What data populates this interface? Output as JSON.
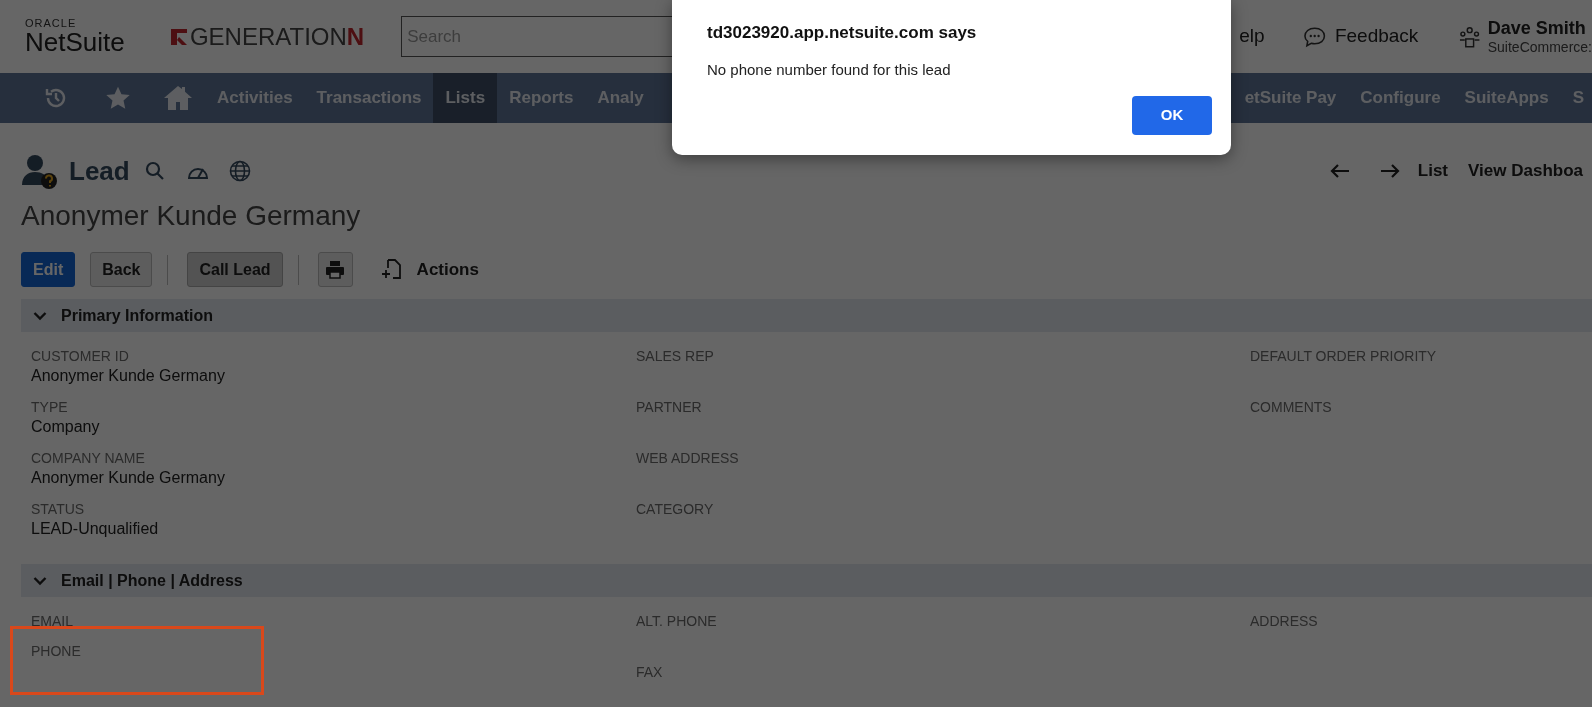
{
  "header": {
    "brand_super": "ORACLE",
    "brand": "NetSuite",
    "partner": {
      "text": "GENERATION",
      "accent": "N"
    },
    "search": {
      "placeholder": "Search"
    },
    "help": "elp",
    "feedback": "Feedback",
    "user": {
      "name": "Dave Smith",
      "role": "SuiteCommerce:"
    }
  },
  "nav": {
    "items_left": [
      {
        "label": "Activities",
        "selected": false
      },
      {
        "label": "Transactions",
        "selected": false
      },
      {
        "label": "Lists",
        "selected": true
      },
      {
        "label": "Reports",
        "selected": false
      },
      {
        "label": "Analy",
        "selected": false
      }
    ],
    "items_right": [
      {
        "label": "etSuite Pay",
        "selected": false
      },
      {
        "label": "Configure",
        "selected": false
      },
      {
        "label": "SuiteApps",
        "selected": false
      },
      {
        "label": "S",
        "selected": false
      }
    ]
  },
  "record": {
    "type": "Lead",
    "name": "Anonymer Kunde Germany",
    "page_links": [
      "List",
      "View Dashboa"
    ],
    "buttons": [
      {
        "label": "Edit",
        "kind": "primary"
      },
      {
        "label": "Back",
        "kind": "secondary"
      },
      {
        "label": "Call Lead",
        "kind": "pressed"
      }
    ],
    "actions": "Actions"
  },
  "sections": [
    {
      "title": "Primary Information",
      "expanded": true,
      "columns": [
        [
          {
            "label": "CUSTOMER ID",
            "value": "Anonymer Kunde Germany",
            "highlighted": false
          },
          {
            "label": "TYPE",
            "value": "Company",
            "highlighted": false
          },
          {
            "label": "COMPANY NAME",
            "value": "Anonymer Kunde Germany",
            "highlighted": false
          },
          {
            "label": "STATUS",
            "value": "LEAD-Unqualified",
            "highlighted": false
          }
        ],
        [
          {
            "label": "SALES REP",
            "highlighted": false
          },
          {
            "label": "PARTNER",
            "highlighted": false
          },
          {
            "label": "WEB ADDRESS",
            "highlighted": false
          },
          {
            "label": "CATEGORY",
            "highlighted": false
          }
        ],
        [
          {
            "label": "DEFAULT ORDER PRIORITY",
            "highlighted": false
          },
          {
            "label": "COMMENTS",
            "highlighted": false
          }
        ]
      ]
    },
    {
      "title": "Email | Phone | Address",
      "expanded": true,
      "columns": [
        [
          {
            "label": "EMAIL",
            "highlighted": false,
            "compact": true
          },
          {
            "label": "PHONE",
            "highlighted": true
          }
        ],
        [
          {
            "label": "ALT. PHONE",
            "highlighted": false
          },
          {
            "label": "FAX",
            "highlighted": false
          }
        ],
        [
          {
            "label": "ADDRESS",
            "highlighted": false
          }
        ]
      ]
    }
  ],
  "dialog": {
    "title": "td3023920.app.netsuite.com says",
    "message": "No phone number found for this lead",
    "button": "OK"
  }
}
